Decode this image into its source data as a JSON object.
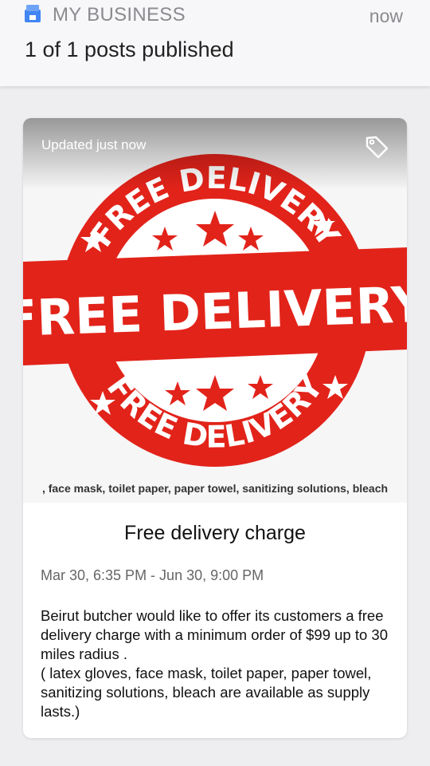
{
  "notification": {
    "app_name": "MY BUSINESS",
    "time": "now",
    "message": "1 of 1 posts published",
    "app_icon": "google-my-business-icon"
  },
  "post": {
    "updated_label": "Updated just now",
    "tag_icon": "tag-icon",
    "image": {
      "arc_top_text": "FREE DELIVERY",
      "banner_text": "FREE DELIVERY",
      "arc_bottom_text": "FREE DELIVERY",
      "supply_text": ", face mask, toilet paper, paper towel, sanitizing solutions, bleach"
    },
    "title": "Free delivery charge",
    "dates": "Mar 30, 6:35 PM - Jun 30, 9:00 PM",
    "body_line1": "Beirut butcher would like to offer its customers a free delivery charge with a minimum order of $99 up to 30 miles radius .",
    "body_line2": "( latex gloves, face mask, toilet paper, paper towel, sanitizing solutions, bleach are available as supply lasts.)"
  },
  "colors": {
    "stamp_red": "#e2231a",
    "background": "#eeeef1",
    "card": "#ffffff"
  }
}
